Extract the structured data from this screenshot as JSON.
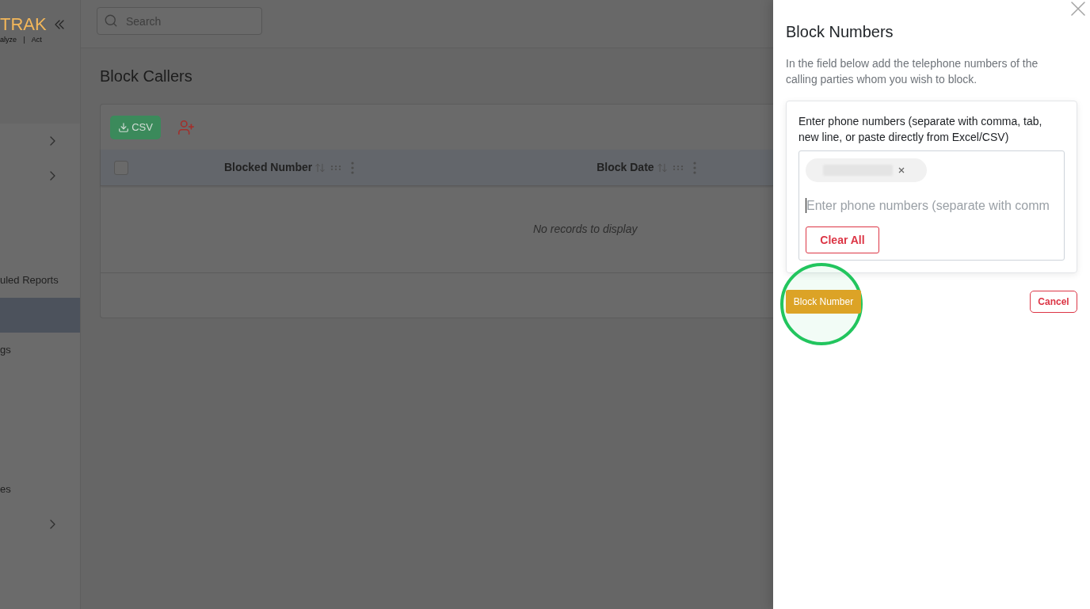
{
  "sidebar": {
    "logo": {
      "wordmark": "TRAK",
      "tagline": "alyze | Act"
    },
    "items": [
      {
        "has_submenu": true,
        "selected": false
      },
      {
        "has_submenu": true,
        "selected": false
      },
      {
        "has_submenu": false,
        "selected": false
      },
      {
        "has_submenu": false,
        "selected": false
      },
      {
        "label": "uled Reports",
        "has_submenu": false,
        "selected": false
      },
      {
        "has_submenu": false,
        "selected": true
      },
      {
        "label": "gs",
        "has_submenu": false,
        "selected": false
      },
      {
        "has_submenu": false,
        "selected": false
      },
      {
        "has_submenu": false,
        "selected": false
      },
      {
        "has_submenu": false,
        "selected": false
      },
      {
        "label": "es",
        "has_submenu": false,
        "selected": false
      },
      {
        "has_submenu": true,
        "selected": false
      }
    ]
  },
  "topbar": {
    "search": {
      "placeholder": "Search"
    }
  },
  "page": {
    "title": "Block Callers"
  },
  "table": {
    "toolbar": {
      "export_button": "CSV"
    },
    "select_all": {
      "checked": false
    },
    "columns": [
      {
        "label": "Blocked Number"
      },
      {
        "label": "Block Date"
      }
    ],
    "empty_message": "No records to display"
  },
  "drawer": {
    "title": "Block Numbers",
    "description": "In the field below add the telephone numbers of the calling parties whom you wish to block.",
    "field_label": "Enter phone numbers (separate with comma, tab, new line, or paste directly from Excel/CSV)",
    "chips": [
      {
        "kind": "blurred"
      }
    ],
    "input": {
      "placeholder": "Enter phone numbers (separate with comm",
      "focused": true
    },
    "clear_button": "Clear All",
    "primary_button": "Block Number",
    "cancel_button": "Cancel"
  }
}
